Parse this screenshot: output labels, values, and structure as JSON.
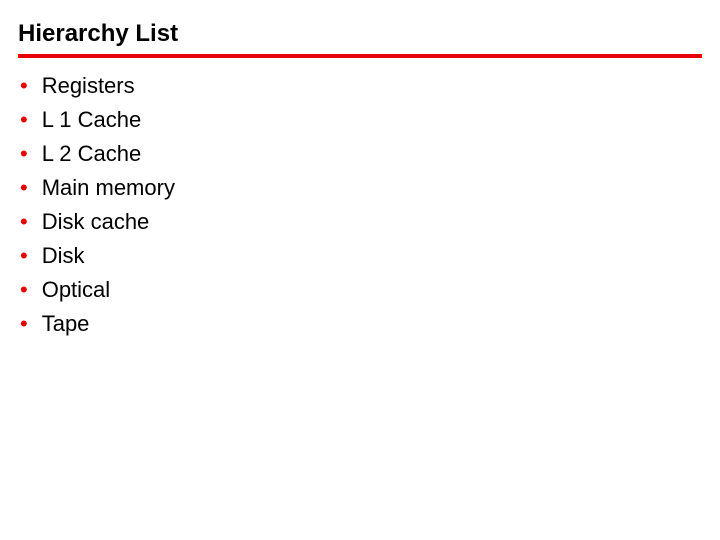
{
  "title": "Hierarchy List",
  "items": [
    {
      "label": "Registers"
    },
    {
      "label": "L 1 Cache"
    },
    {
      "label": "L 2 Cache"
    },
    {
      "label": "Main memory"
    },
    {
      "label": "Disk cache"
    },
    {
      "label": "Disk"
    },
    {
      "label": "Optical"
    },
    {
      "label": "Tape"
    }
  ]
}
